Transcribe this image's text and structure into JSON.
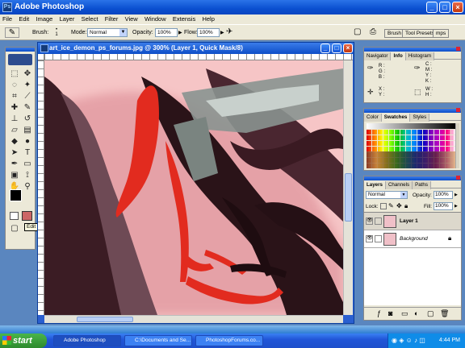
{
  "app": {
    "title": "Adobe Photoshop"
  },
  "menu": [
    "File",
    "Edit",
    "Image",
    "Layer",
    "Select",
    "Filter",
    "View",
    "Window",
    "Extensis",
    "Help"
  ],
  "options": {
    "brush_label": "Brush:",
    "brush_size": "1",
    "mode_label": "Mode:",
    "mode_value": "Normal",
    "opacity_label": "Opacity:",
    "opacity_value": "100%",
    "flow_label": "Flow:",
    "flow_value": "100%",
    "well_tabs": [
      "Brush",
      "Tool Presets",
      "mps"
    ]
  },
  "tooltip": "Edit in Quick Mask Mode (Q)",
  "document": {
    "title": "art_ice_demon_ps_forums.jpg @ 300% (Layer 1, Quick Mask/8)"
  },
  "navigator_panel": {
    "tabs": [
      "Navigator",
      "Info",
      "Histogram"
    ],
    "active_tab": "Info",
    "info_left": [
      "R :",
      "G :",
      "B :"
    ],
    "info_right": [
      "C :",
      "M :",
      "Y :",
      "K :"
    ],
    "info_bottom_left": [
      "X :",
      "Y :"
    ],
    "info_bottom_right": [
      "W :",
      "H :"
    ]
  },
  "swatches_panel": {
    "tabs": [
      "Color",
      "Swatches",
      "Styles"
    ],
    "active_tab": "Swatches"
  },
  "layers_panel": {
    "tabs": [
      "Layers",
      "Channels",
      "Paths"
    ],
    "active_tab": "Layers",
    "blend_mode": "Normal",
    "opacity_label": "Opacity:",
    "opacity_value": "100%",
    "lock_label": "Lock:",
    "fill_label": "Fill:",
    "fill_value": "100%",
    "layers": [
      {
        "name": "Layer 1",
        "italic": false
      },
      {
        "name": "Background",
        "italic": true
      }
    ]
  },
  "taskbar": {
    "start_label": "start",
    "items": [
      "Adobe Photoshop",
      "C:\\Documents and Se...",
      "PhotoshopForums.co..."
    ],
    "clock": "4:44 PM"
  },
  "colors": {
    "quick_mask_overlay": "#f6c5c6",
    "mask_red": "#e22b1f",
    "xp_blue": "#0a4fd0"
  }
}
